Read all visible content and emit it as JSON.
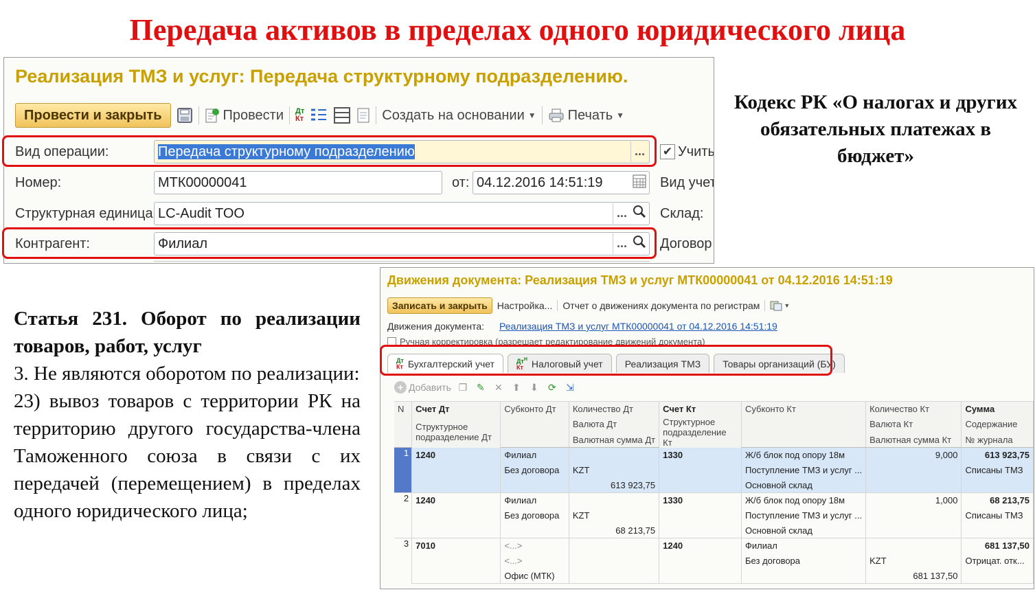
{
  "slide": {
    "title": "Передача активов в пределах одного юридического лица"
  },
  "panel1": {
    "title": "Реализация ТМЗ и услуг: Передача структурному подразделению.",
    "toolbar": {
      "post_close": "Провести и закрыть",
      "post": "Провести",
      "create_based": "Создать на основании",
      "print": "Печать"
    },
    "fields": {
      "operation_label": "Вид операции:",
      "operation_value": "Передача структурному подразделению",
      "number_label": "Номер:",
      "number_value": "МТК00000041",
      "date_label": "от:",
      "date_value": "04.12.2016 14:51:19",
      "unit_label": "Структурная единица:",
      "unit_value": "LC-Audit TOO",
      "counterparty_label": "Контрагент:",
      "counterparty_value": "Филиал",
      "right_1": "Учить",
      "right_2": "Вид учет",
      "right_3": "Склад:",
      "right_4": "Договор"
    }
  },
  "tax_code": {
    "text": "Кодекс РК «О налогах и других обязательных платежах в бюджет»"
  },
  "article": {
    "heading": "Статья 231. Оборот по реализации товаров, работ, услуг",
    "p1": "3. Не являются оборотом по реализации:",
    "p2": "23) вывоз товаров с территории РК на территорию другого государства-члена Таможенного союза в связи с их передачей (перемещением) в пределах одного юридического лица;"
  },
  "panel2": {
    "title": "Движения документа: Реализация ТМЗ и услуг МТК00000041 от 04.12.2016 14:51:19",
    "toolbar": {
      "save_close": "Записать и закрыть",
      "settings": "Настройка...",
      "report": "Отчет о движениях документа по регистрам"
    },
    "movements_label": "Движения документа:",
    "movements_link": "Реализация ТМЗ и услуг МТК00000041 от 04.12.2016 14:51:19",
    "manual": "Ручная корректировка (разрешает редактирование движений документа)",
    "tabs": [
      "Бухгалтерский учет",
      "Налоговый учет",
      "Реализация ТМЗ",
      "Товары организаций (БУ)"
    ],
    "add": "Добавить",
    "headers": {
      "n": "N",
      "schet_dt": "Счет Дт",
      "subkonto_dt": "Субконто Дт",
      "kol_dt": "Количество Дт",
      "schet_kt": "Счет Кт",
      "subkonto_kt": "Субконто Кт",
      "kol_kt": "Количество Кт",
      "summa": "Сумма",
      "struct_dt": "Структурное подразделение Дт",
      "val_dt": "Валюта Дт",
      "struct_kt": "Структурное подразделение Кт",
      "val_kt": "Валюта Кт",
      "soderzhanie": "Содержание",
      "valsum_dt": "Валютная сумма Дт",
      "valsum_kt": "Валютная сумма Кт",
      "zhurnal": "№ журнала"
    },
    "rows": [
      {
        "n": "1",
        "schet_dt": "1240",
        "sub_dt": [
          "Филиал",
          "Без договора",
          ""
        ],
        "val_dt": "KZT",
        "valsum_dt": "613 923,75",
        "schet_kt": "1330",
        "sub_kt": [
          "Ж/б блок под опору 18м",
          "Поступление ТМЗ и услуг ...",
          "Основной склад"
        ],
        "kol_kt": "9,000",
        "summa": "613 923,75",
        "soderzhanie": "Списаны ТМЗ"
      },
      {
        "n": "2",
        "schet_dt": "1240",
        "sub_dt": [
          "Филиал",
          "Без договора",
          ""
        ],
        "val_dt": "KZT",
        "valsum_dt": "68 213,75",
        "schet_kt": "1330",
        "sub_kt": [
          "Ж/б блок под опору 18м",
          "Поступление ТМЗ и услуг ...",
          "Основной склад"
        ],
        "kol_kt": "1,000",
        "summa": "68 213,75",
        "soderzhanie": "Списаны ТМЗ"
      },
      {
        "n": "3",
        "schet_dt": "7010",
        "sub_dt": [
          "<...>",
          "<...>",
          "Офис (МТК)"
        ],
        "val_dt": "",
        "valsum_dt": "",
        "schet_kt": "1240",
        "sub_kt": [
          "Филиал",
          "Без договора",
          ""
        ],
        "val_kt": "KZT",
        "valsum_kt": "681 137,50",
        "kol_kt": "",
        "summa": "681 137,50",
        "soderzhanie": "Отрицат. отк..."
      }
    ]
  },
  "colors": {
    "title_red": "#e01010",
    "header_gold": "#c8a000",
    "link_blue": "#1a55b8",
    "selection_blue": "#5579c9"
  }
}
